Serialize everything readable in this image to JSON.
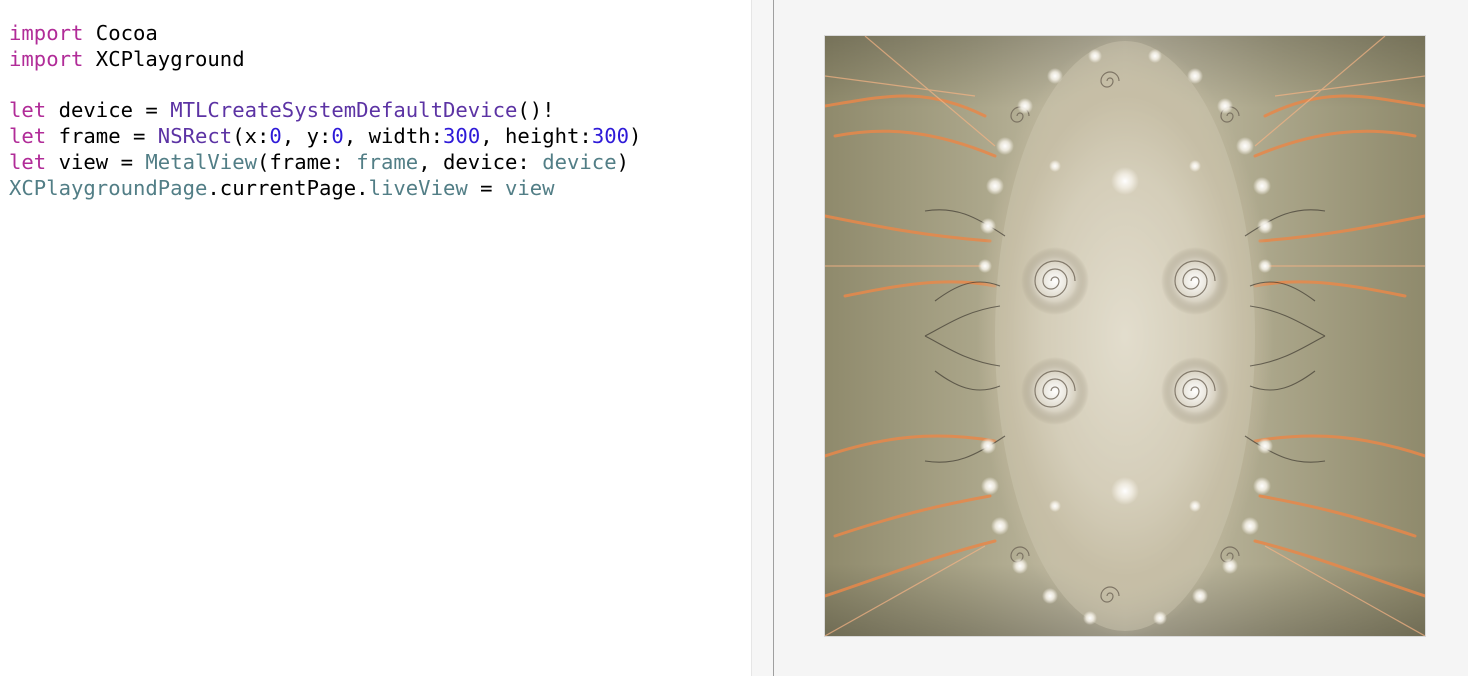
{
  "editor": {
    "lines": [
      [
        {
          "t": "import",
          "c": "kw"
        },
        {
          "t": " Cocoa",
          "c": "plain"
        }
      ],
      [
        {
          "t": "import",
          "c": "kw"
        },
        {
          "t": " XCPlayground",
          "c": "plain"
        }
      ],
      [],
      [
        {
          "t": "let",
          "c": "kw"
        },
        {
          "t": " device = ",
          "c": "plain"
        },
        {
          "t": "MTLCreateSystemDefaultDevice",
          "c": "fn"
        },
        {
          "t": "()!",
          "c": "plain"
        }
      ],
      [
        {
          "t": "let",
          "c": "kw"
        },
        {
          "t": " frame = ",
          "c": "plain"
        },
        {
          "t": "NSRect",
          "c": "fn"
        },
        {
          "t": "(x:",
          "c": "plain"
        },
        {
          "t": "0",
          "c": "num"
        },
        {
          "t": ", y:",
          "c": "plain"
        },
        {
          "t": "0",
          "c": "num"
        },
        {
          "t": ", width:",
          "c": "plain"
        },
        {
          "t": "300",
          "c": "num"
        },
        {
          "t": ", height:",
          "c": "plain"
        },
        {
          "t": "300",
          "c": "num"
        },
        {
          "t": ")",
          "c": "plain"
        }
      ],
      [
        {
          "t": "let",
          "c": "kw"
        },
        {
          "t": " view = ",
          "c": "plain"
        },
        {
          "t": "MetalView",
          "c": "tp"
        },
        {
          "t": "(frame: ",
          "c": "plain"
        },
        {
          "t": "frame",
          "c": "tp"
        },
        {
          "t": ", device: ",
          "c": "plain"
        },
        {
          "t": "device",
          "c": "tp"
        },
        {
          "t": ")",
          "c": "plain"
        }
      ],
      [
        {
          "t": "XCPlaygroundPage",
          "c": "tp"
        },
        {
          "t": ".currentPage.",
          "c": "plain"
        },
        {
          "t": "liveView",
          "c": "tp"
        },
        {
          "t": " = ",
          "c": "plain"
        },
        {
          "t": "view",
          "c": "tp"
        }
      ]
    ]
  },
  "live_view": {
    "content": "fractal-render-image",
    "colors": {
      "background": "#a7a283",
      "glow": "#f2eee4",
      "accent": "#e8884a",
      "dark": "#2f2a24"
    }
  },
  "colors": {
    "keyword": "#b12c98",
    "function": "#5c33a4",
    "number": "#2e1ad8",
    "type": "#527e86",
    "divider": "#9f9f9f",
    "live_background": "#f5f5f5"
  }
}
